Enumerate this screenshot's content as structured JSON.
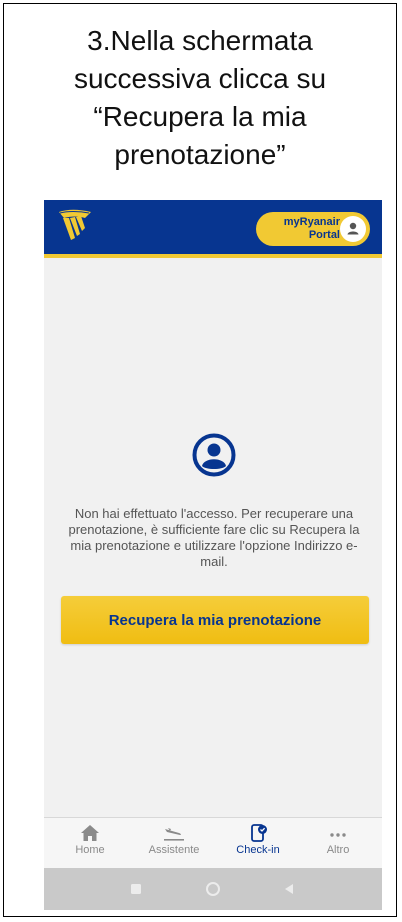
{
  "caption": {
    "lines": [
      "3.Nella schermata",
      "successiva clicca su",
      "“Recupera la mia",
      "prenotazione”"
    ]
  },
  "header": {
    "logo": "ryanair-harp-logo",
    "portal_label": "myRyanair\nPortal",
    "portal_icon": "user-icon",
    "colors": {
      "brand_blue": "#073590",
      "brand_yellow": "#f1c933"
    }
  },
  "main": {
    "icon": "account-circle-icon",
    "message": "Non hai effettuato l'accesso. Per recuperare una prenotazione, è sufficiente fare clic su Recupera la mia prenotazione e utilizzare l'opzione Indirizzo e-mail.",
    "cta_label": "Recupera la mia prenotazione"
  },
  "tabbar": {
    "tabs": [
      {
        "label": "Home",
        "icon": "home-icon",
        "active": false
      },
      {
        "label": "Assistente",
        "icon": "plane-landing-icon",
        "active": false
      },
      {
        "label": "Check-in",
        "icon": "phone-check-icon",
        "active": true
      },
      {
        "label": "Altro",
        "icon": "more-dots-icon",
        "active": false
      }
    ]
  },
  "system_nav": {
    "buttons": [
      "recents-square-icon",
      "home-circle-icon",
      "back-triangle-icon"
    ]
  }
}
